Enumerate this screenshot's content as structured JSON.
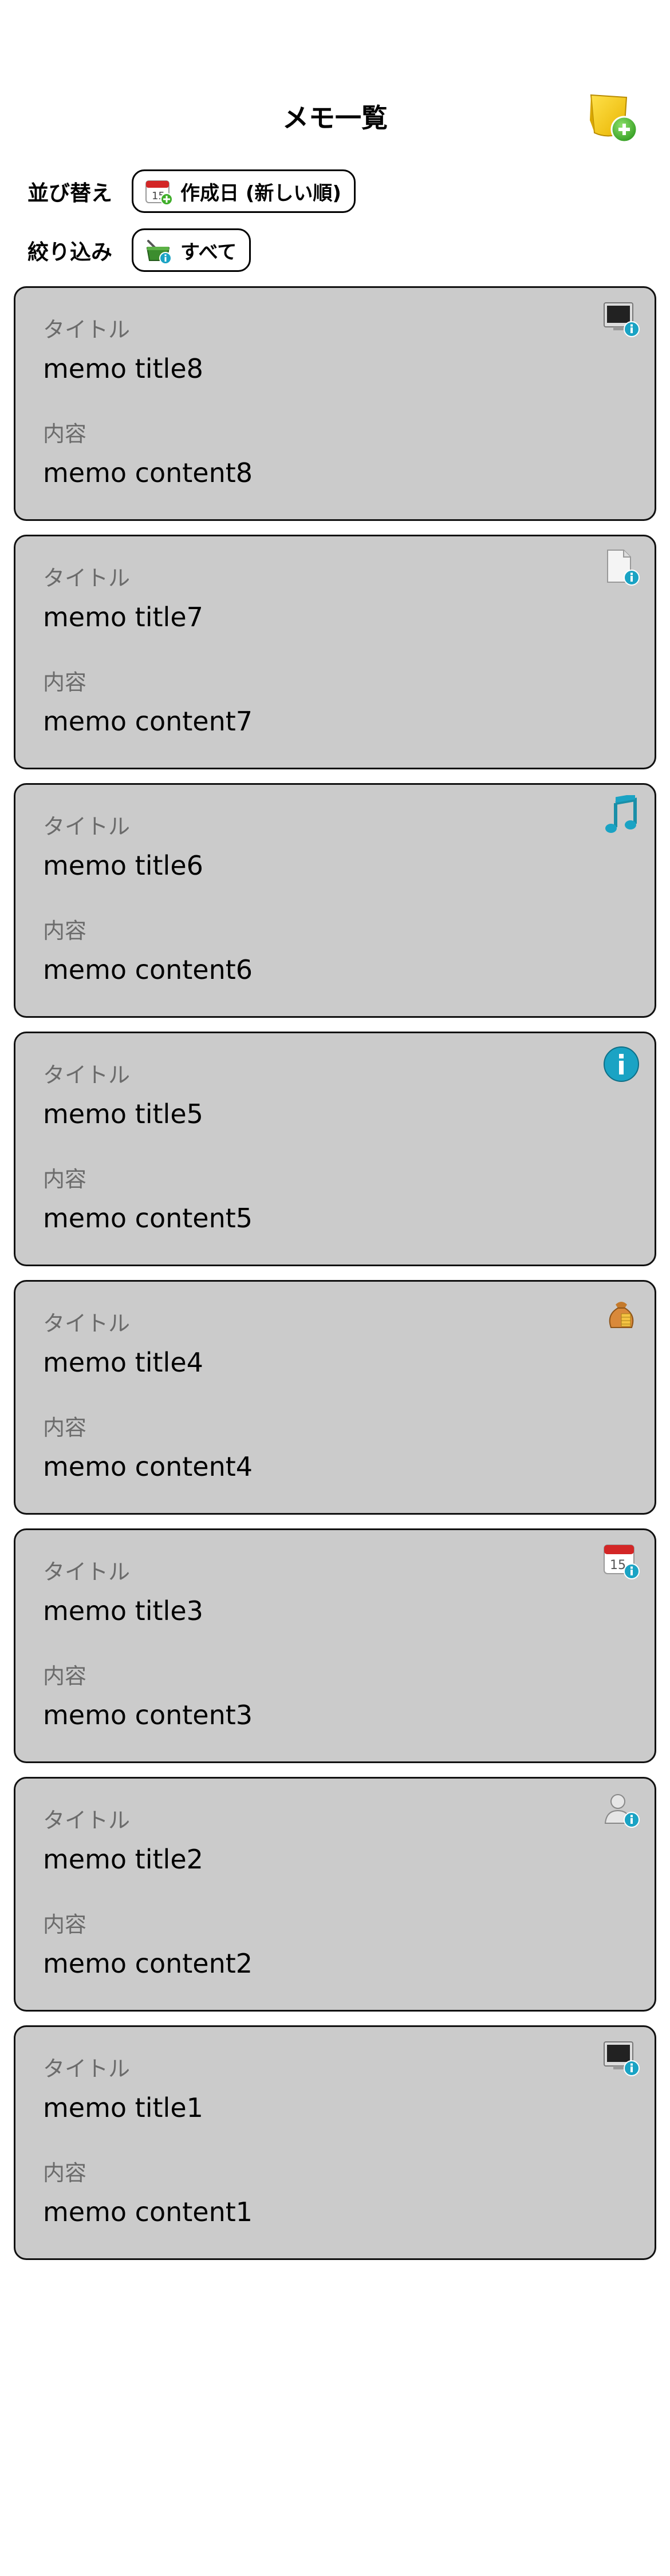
{
  "header": {
    "title": "メモ一覧",
    "add_icon": "note-add-icon"
  },
  "sort": {
    "label": "並び替え",
    "value": "作成日 (新しい順)",
    "icon": "calendar-icon"
  },
  "filter": {
    "label": "絞り込み",
    "value": "すべて",
    "icon": "basket-icon"
  },
  "memos": [
    {
      "title_label": "タイトル",
      "title": "memo title8",
      "content_label": "内容",
      "content": "memo content8",
      "icon": "monitor-info-icon"
    },
    {
      "title_label": "タイトル",
      "title": "memo title7",
      "content_label": "内容",
      "content": "memo content7",
      "icon": "document-info-icon"
    },
    {
      "title_label": "タイトル",
      "title": "memo title6",
      "content_label": "内容",
      "content": "memo content6",
      "icon": "music-note-icon"
    },
    {
      "title_label": "タイトル",
      "title": "memo title5",
      "content_label": "内容",
      "content": "memo content5",
      "icon": "info-icon"
    },
    {
      "title_label": "タイトル",
      "title": "memo title4",
      "content_label": "内容",
      "content": "memo content4",
      "icon": "money-bag-icon"
    },
    {
      "title_label": "タイトル",
      "title": "memo title3",
      "content_label": "内容",
      "content": "memo content3",
      "icon": "calendar-info-icon"
    },
    {
      "title_label": "タイトル",
      "title": "memo title2",
      "content_label": "内容",
      "content": "memo content2",
      "icon": "user-info-icon"
    },
    {
      "title_label": "タイトル",
      "title": "memo title1",
      "content_label": "内容",
      "content": "memo content1",
      "icon": "monitor-info-icon"
    }
  ],
  "colors": {
    "card_background": "#cbcbcb",
    "label_gray": "#6b6b6b",
    "info_badge": "#1aa3c4"
  }
}
